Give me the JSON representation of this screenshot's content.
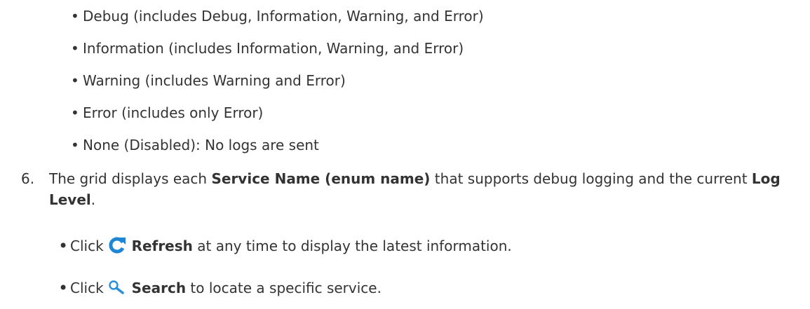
{
  "levels": [
    "Debug (includes Debug, Information, Warning, and Error)",
    "Information (includes Information, Warning, and Error)",
    "Warning (includes Warning and Error)",
    "Error (includes only Error)",
    "None (Disabled): No logs are sent"
  ],
  "step": {
    "number": "6.",
    "text_a": "The grid displays each ",
    "bold_a": "Service Name (enum name)",
    "text_b": " that supports debug logging and the current ",
    "bold_b": "Log Level",
    "text_c": "."
  },
  "actions": [
    {
      "prefix": "Click",
      "icon": "refresh-icon",
      "label": "Refresh",
      "suffix": " at any time to display the latest information."
    },
    {
      "prefix": "Click",
      "icon": "search-icon",
      "label": "Search",
      "suffix": " to locate a specific service."
    }
  ],
  "colors": {
    "icon_blue": "#1f86d6",
    "text": "#333333"
  }
}
